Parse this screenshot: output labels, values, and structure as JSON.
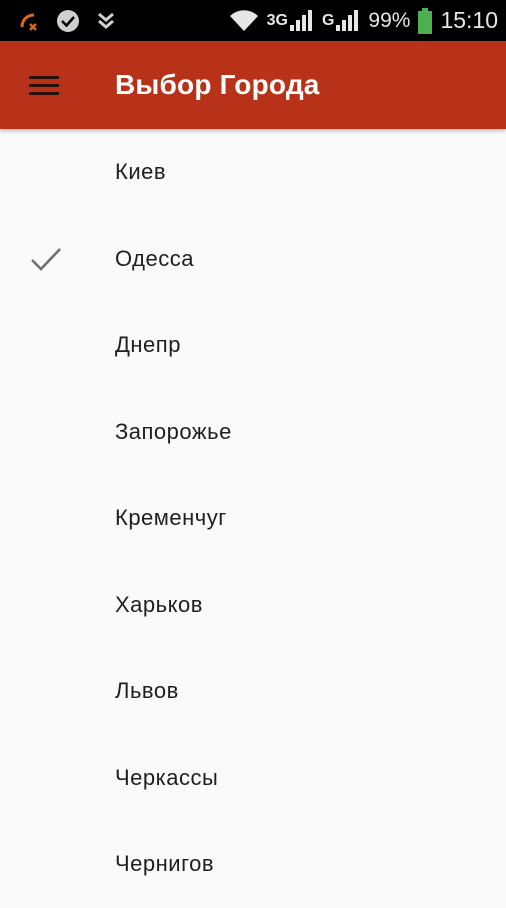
{
  "status_bar": {
    "signal_1": "3G",
    "signal_2": "G",
    "battery": "99%",
    "time": "15:10"
  },
  "app_bar": {
    "title": "Выбор Города"
  },
  "cities": [
    {
      "label": "Киев",
      "selected": false
    },
    {
      "label": "Одесса",
      "selected": true
    },
    {
      "label": "Днепр",
      "selected": false
    },
    {
      "label": "Запорожье",
      "selected": false
    },
    {
      "label": "Кременчуг",
      "selected": false
    },
    {
      "label": "Харьков",
      "selected": false
    },
    {
      "label": "Львов",
      "selected": false
    },
    {
      "label": "Черкассы",
      "selected": false
    },
    {
      "label": "Чернигов",
      "selected": false
    }
  ],
  "colors": {
    "app_bar": "#b83219",
    "background": "#fafafa",
    "text": "#1f1f1f",
    "check": "#707070"
  }
}
